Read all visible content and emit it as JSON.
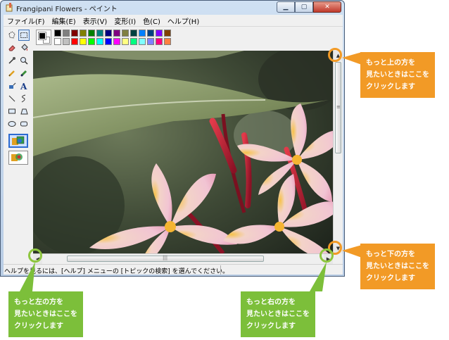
{
  "window": {
    "title": "Frangipani Flowers - ペイント"
  },
  "menu": {
    "items": [
      "ファイル(F)",
      "編集(E)",
      "表示(V)",
      "変形(I)",
      "色(C)",
      "ヘルプ(H)"
    ]
  },
  "palette": {
    "foreground": "#000000",
    "background": "#ffffff",
    "colors": [
      "#000000",
      "#808080",
      "#800000",
      "#808000",
      "#008000",
      "#008080",
      "#000080",
      "#800080",
      "#808040",
      "#004040",
      "#0080ff",
      "#004080",
      "#8000ff",
      "#804000",
      "#ffffff",
      "#c0c0c0",
      "#ff0000",
      "#ffff00",
      "#00ff00",
      "#00ffff",
      "#0000ff",
      "#ff00ff",
      "#ffff80",
      "#00ff80",
      "#80ffff",
      "#8080ff",
      "#ff0080",
      "#ff8040"
    ]
  },
  "status": {
    "text": "ヘルプを見るには、[ヘルプ] メニューの [トピックの検索] を選んでください。"
  },
  "callouts": {
    "up": [
      "もっと上の方を",
      "見たいときはここを",
      "クリックします"
    ],
    "down": [
      "もっと下の方を",
      "見たいときはここを",
      "クリックします"
    ],
    "left": [
      "もっと左の方を",
      "見たいときはここを",
      "クリックします"
    ],
    "right": [
      "もっと右の方を",
      "見たいときはここを",
      "クリックします"
    ],
    "orange": "#f29a26",
    "green": "#7cbf3a"
  }
}
